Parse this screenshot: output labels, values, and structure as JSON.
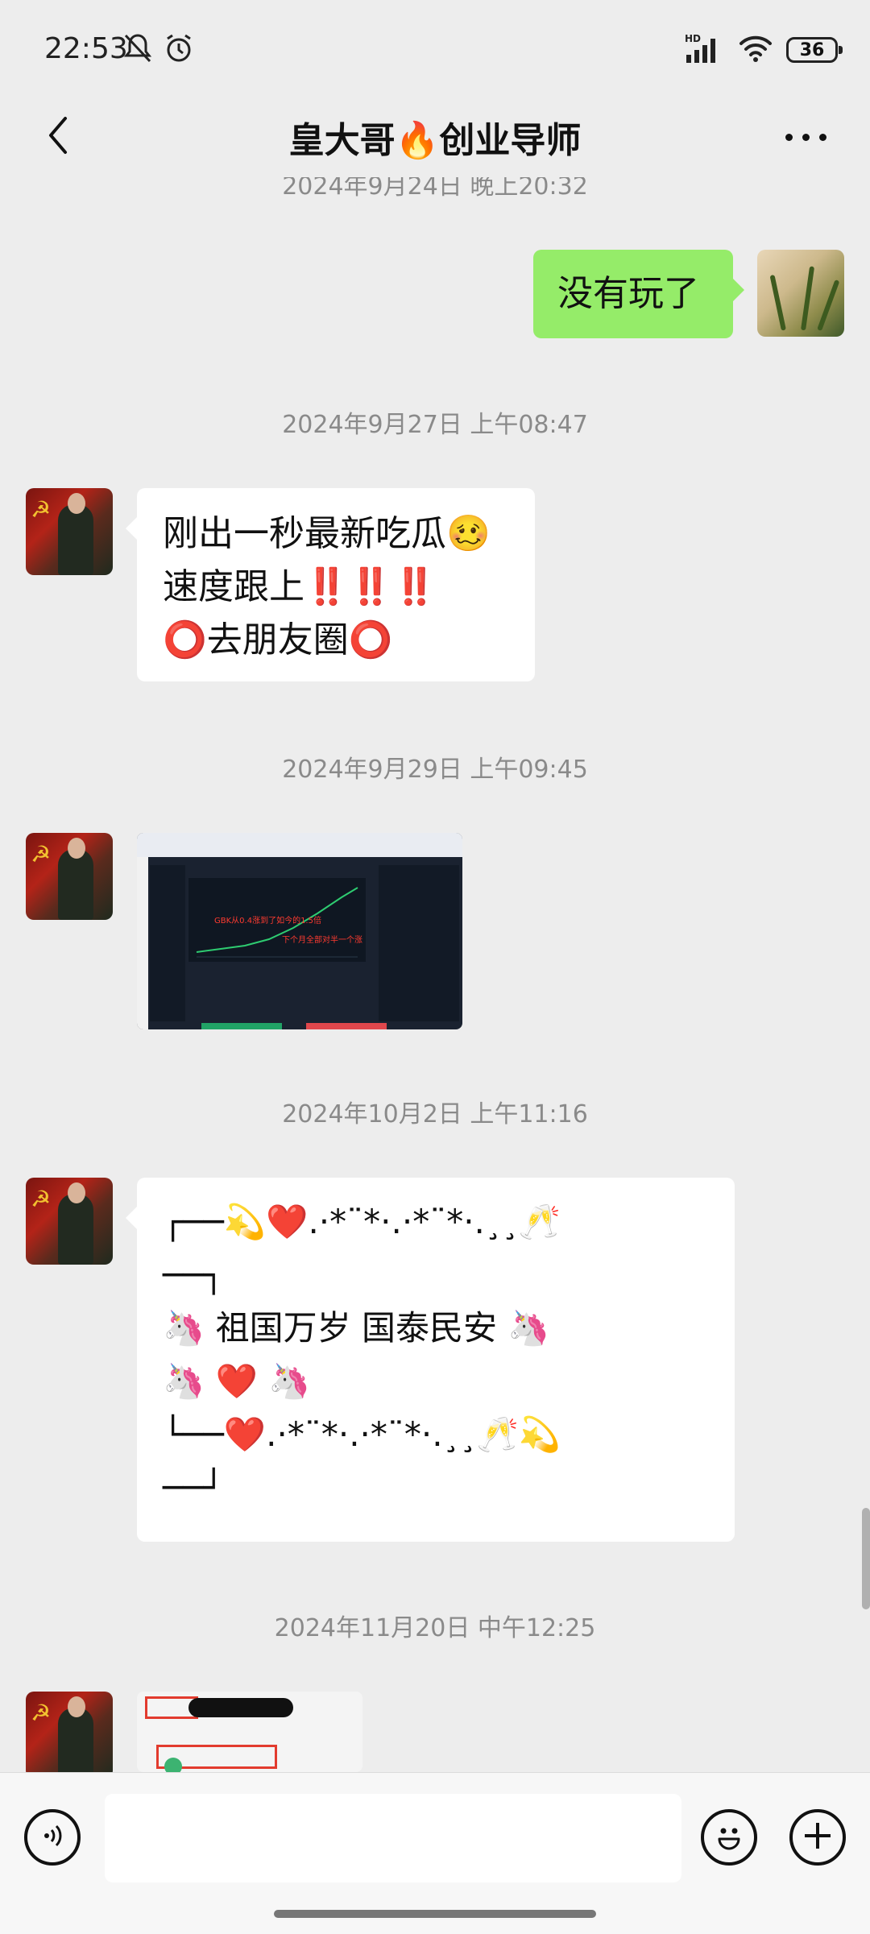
{
  "status_bar": {
    "time": "22:53",
    "network": "HD",
    "battery": "36"
  },
  "header": {
    "title": "皇大哥🔥创业导师"
  },
  "messages": {
    "partial_timestamp": "2024年9月24日 晚上20:32",
    "msg_out_1": "没有玩了",
    "ts_1": "2024年9月27日 上午08:47",
    "msg_in_1": [
      "刚出一秒最新吃瓜🥴",
      "速度跟上‼️‼️‼️",
      "⭕去朋友圈⭕"
    ],
    "ts_2": "2024年9月29日 上午09:45",
    "screenshot_1_text": [
      "GBK从0.4涨到了如今的1.5倍",
      "下个月全部对半一个涨"
    ],
    "ts_3": "2024年10月2日 上午11:16",
    "msg_in_2": [
      "┌──💫❤️.·*¨*·.·*¨*·.¸¸🥂",
      "──┐",
      "🦄 祖国万岁 国泰民安 🦄",
      "🦄 ❤️ 🦄",
      "└──❤️.·*¨*·.·*¨*·.¸¸🥂💫",
      "──┘"
    ],
    "ts_4": "2024年11月20日 中午12:25"
  },
  "input": {
    "placeholder": ""
  },
  "icons": {
    "back": "chevron-left-icon",
    "more": "more-dots-icon",
    "voice": "voice-icon",
    "emoji": "emoji-icon",
    "add": "plus-icon"
  }
}
